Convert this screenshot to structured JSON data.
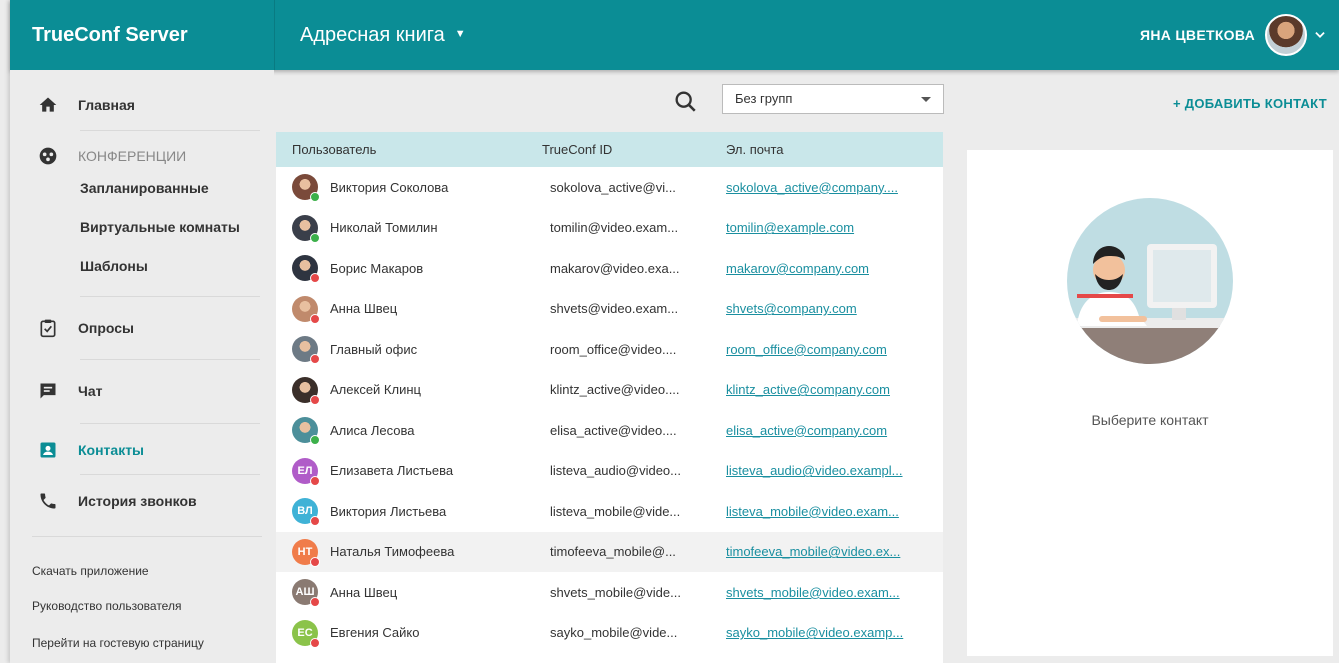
{
  "header": {
    "brand": "TrueConf Server",
    "page_title": "Адресная книга",
    "user_name": "ЯНА ЦВЕТКОВА"
  },
  "sidebar": {
    "home": "Главная",
    "conferences_group": "КОНФЕРЕНЦИИ",
    "scheduled": "Запланированные",
    "virtual_rooms": "Виртуальные комнаты",
    "templates": "Шаблоны",
    "polls": "Опросы",
    "chat": "Чат",
    "contacts": "Контакты",
    "call_history": "История звонков",
    "download_app": "Скачать приложение",
    "user_guide": "Руководство пользователя",
    "guest_page": "Перейти на гостевую страницу"
  },
  "toolbar": {
    "group_select_value": "Без групп",
    "add_contact": "+ ДОБАВИТЬ КОНТАКТ"
  },
  "table": {
    "headers": {
      "user": "Пользователь",
      "trueconf_id": "TrueConf ID",
      "email": "Эл. почта"
    },
    "rows": [
      {
        "name": "Виктория Соколова",
        "id": "sokolova_active@vi...",
        "email": "sokolova_active@company....",
        "avatar": "photo",
        "avatar_color": "#7a4a3a",
        "status_color": "#3cb04a"
      },
      {
        "name": "Николай Томилин",
        "id": "tomilin@video.exam...",
        "email": "tomilin@example.com",
        "avatar": "photo",
        "avatar_color": "#3a3f4a",
        "status_color": "#3cb04a"
      },
      {
        "name": "Борис Макаров",
        "id": "makarov@video.exa...",
        "email": "makarov@company.com",
        "avatar": "photo",
        "avatar_color": "#2e3440",
        "status_color": "#e54848"
      },
      {
        "name": "Анна Швец",
        "id": "shvets@video.exam...",
        "email": "shvets@company.com",
        "avatar": "photo",
        "avatar_color": "#c08a6c",
        "status_color": "#e54848"
      },
      {
        "name": "Главный офис",
        "id": "room_office@video....",
        "email": "room_office@company.com",
        "avatar": "photo",
        "avatar_color": "#6d7a85",
        "status_color": "#e54848"
      },
      {
        "name": "Алексей Клинц",
        "id": "klintz_active@video....",
        "email": "klintz_active@company.com",
        "avatar": "photo",
        "avatar_color": "#3b2f2a",
        "status_color": "#e54848"
      },
      {
        "name": "Алиса Лесова",
        "id": "elisa_active@video....",
        "email": "elisa_active@company.com",
        "avatar": "photo",
        "avatar_color": "#4c8f9a",
        "status_color": "#3cb04a"
      },
      {
        "name": "Елизавета Листьева",
        "id": "listeva_audio@video...",
        "email": "listeva_audio@video.exampl...",
        "avatar": "ЕЛ",
        "avatar_color": "#b05cc8",
        "status_color": "#e54848"
      },
      {
        "name": "Виктория Листьева",
        "id": "listeva_mobile@vide...",
        "email": "listeva_mobile@video.exam...",
        "avatar": "ВЛ",
        "avatar_color": "#3fb2d6",
        "status_color": "#e54848"
      },
      {
        "name": "Наталья Тимофеева",
        "id": "timofeeva_mobile@...",
        "email": "timofeeva_mobile@video.ex...",
        "avatar": "НТ",
        "avatar_color": "#f07c4a",
        "status_color": "#e54848",
        "highlight": true
      },
      {
        "name": "Анна Швец",
        "id": "shvets_mobile@vide...",
        "email": "shvets_mobile@video.exam...",
        "avatar": "АШ",
        "avatar_color": "#8a7a72",
        "status_color": "#e54848"
      },
      {
        "name": "Евгения Сайко",
        "id": "sayko_mobile@vide...",
        "email": "sayko_mobile@video.examp...",
        "avatar": "ЕС",
        "avatar_color": "#8bc34a",
        "status_color": "#e54848"
      }
    ]
  },
  "contact_panel": {
    "placeholder_text": "Выберите контакт"
  },
  "colors": {
    "brand": "#0b8d95",
    "table_header": "#c9e7ea",
    "link": "#1a8fa0"
  }
}
